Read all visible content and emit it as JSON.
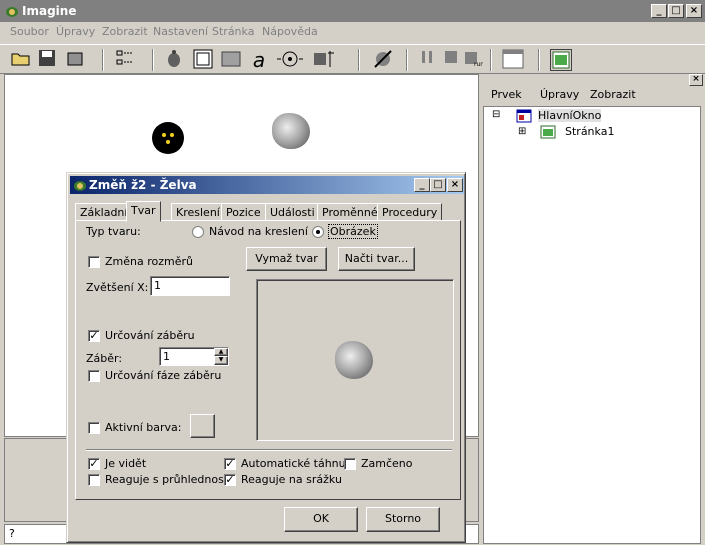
{
  "window": {
    "title": "Imagine",
    "min": "_",
    "max": "□",
    "close": "×"
  },
  "menu": [
    "Soubor",
    "Úpravy",
    "Zobrazit",
    "Nastavení",
    "Stránka",
    "Nápověda"
  ],
  "right_panel": {
    "menu": [
      "Prvek",
      "Úpravy",
      "Zobrazit"
    ],
    "tree": [
      {
        "expander": "⊟",
        "label": "HlavníOkno"
      },
      {
        "expander": "⊞",
        "label": "Stránka1"
      }
    ]
  },
  "command_line": "?",
  "dialog": {
    "title": "Změň ž2  - Želva",
    "tabs": [
      "Základní",
      "Tvar",
      "Kreslení",
      "Pozice",
      "Události",
      "Proměnné",
      "Procedury"
    ],
    "active_tab": "Tvar",
    "typ_tvaru_label": "Typ tvaru:",
    "radio_navod": "Návod na kreslení",
    "radio_obrazek": "Obrázek",
    "zmena_rozmeru": "Změna rozměrů",
    "btn_vymaz": "Vymaž tvar",
    "btn_nacti": "Načti tvar...",
    "zvetseni_label": "Zvětšení X:",
    "zvetseni_value": "1",
    "urcovani_zaberu": "Určování záběru",
    "zaber_label": "Záběr:",
    "zaber_value": "1",
    "urcovani_faze": "Určování fáze záběru",
    "aktivni_barva": "Aktivní barva:",
    "je_videt": "Je vidět",
    "reaguje_pruhlednosti": "Reaguje s průhledností",
    "automaticke_tahnuti": "Automatické táhnutí",
    "reaguje_srazku": "Reaguje na srážku",
    "zamceno": "Zamčeno",
    "ok": "OK",
    "storno": "Storno",
    "checked_mark": "✓"
  }
}
